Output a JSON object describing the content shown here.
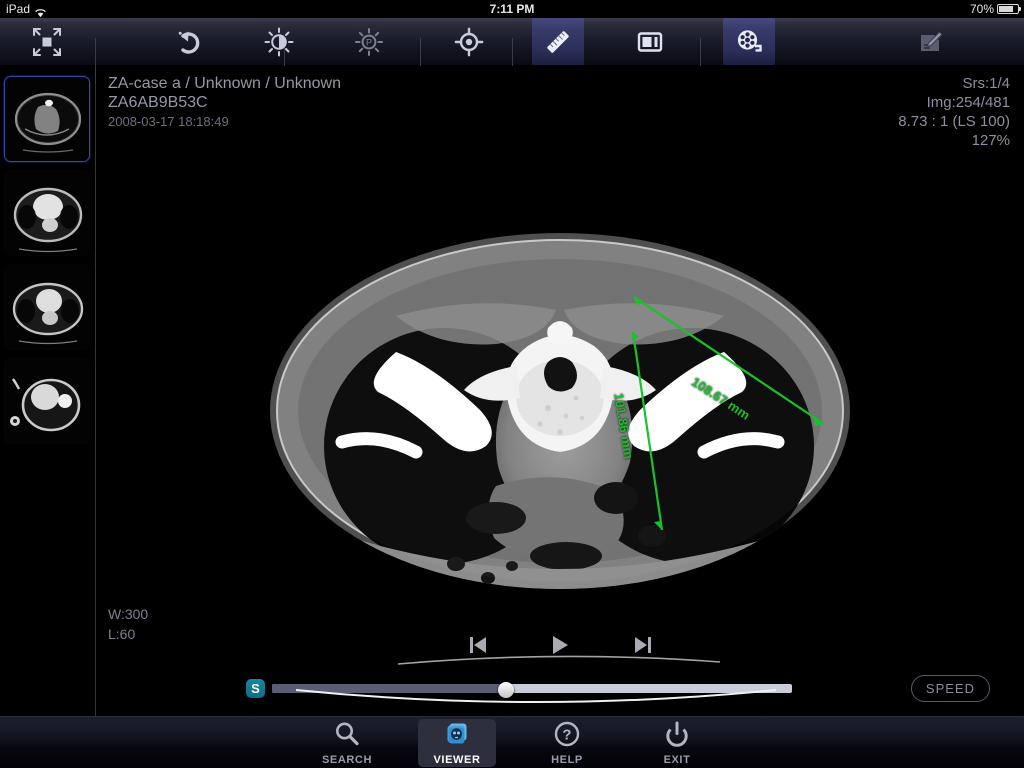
{
  "status_bar": {
    "device": "iPad",
    "wifi_icon": "wifi-icon",
    "time": "7:11 PM",
    "battery_percent": "70%",
    "battery_icon": "battery-icon"
  },
  "toolbar": {
    "buttons": [
      {
        "name": "fit-to-screen-button",
        "icon": "fit-to-screen-icon",
        "active": false
      },
      {
        "name": "undo-button",
        "icon": "undo-icon",
        "active": false
      },
      {
        "name": "window-level-button",
        "icon": "brightness-contrast-icon",
        "active": false
      },
      {
        "name": "preset-window-button",
        "icon": "brightness-preset-icon",
        "active": false
      },
      {
        "name": "crosshair-button",
        "icon": "crosshair-target-icon",
        "active": false
      },
      {
        "name": "measure-button",
        "icon": "ruler-icon",
        "active": true
      },
      {
        "name": "layout-button",
        "icon": "layout-panel-icon",
        "active": false
      },
      {
        "name": "cine-button",
        "icon": "film-reel-icon",
        "active": true
      },
      {
        "name": "annotate-button",
        "icon": "document-pencil-icon",
        "active": false
      }
    ]
  },
  "sidebar": {
    "thumbnails": [
      {
        "label": "series-thumbnail-1",
        "selected": true
      },
      {
        "label": "series-thumbnail-2",
        "selected": false
      },
      {
        "label": "series-thumbnail-3",
        "selected": false
      },
      {
        "label": "series-thumbnail-4",
        "selected": false
      }
    ]
  },
  "viewport": {
    "patient_line": "ZA-case a / Unknown / Unknown",
    "study_id": "ZA6AB9B53C",
    "study_datetime": "2008-03-17 18:18:49",
    "series_index": "Srs:1/4",
    "image_index": "Img:254/481",
    "compression": "8.73 : 1 (LS 100)",
    "zoom_percent": "127%",
    "window_width": "W:300",
    "window_level": "L:60",
    "measurement_color": "#17c22a",
    "measurements": [
      {
        "name": "measurement-1",
        "value": "108.67 mm"
      },
      {
        "name": "measurement-2",
        "value": "101.86 mm"
      }
    ]
  },
  "playback": {
    "prev_icon": "skip-previous-icon",
    "play_icon": "play-icon",
    "next_icon": "skip-next-icon",
    "slider_badge": "S",
    "slider_percent": 45,
    "speed_label": "SPEED"
  },
  "tabbar": {
    "tabs": [
      {
        "name": "tab-search",
        "label": "SEARCH",
        "icon": "search-icon",
        "active": false
      },
      {
        "name": "tab-viewer",
        "label": "VIEWER",
        "icon": "viewer-stack-icon",
        "active": true
      },
      {
        "name": "tab-help",
        "label": "HELP",
        "icon": "question-circle-icon",
        "active": false
      },
      {
        "name": "tab-exit",
        "label": "EXIT",
        "icon": "power-icon",
        "active": false
      }
    ]
  }
}
